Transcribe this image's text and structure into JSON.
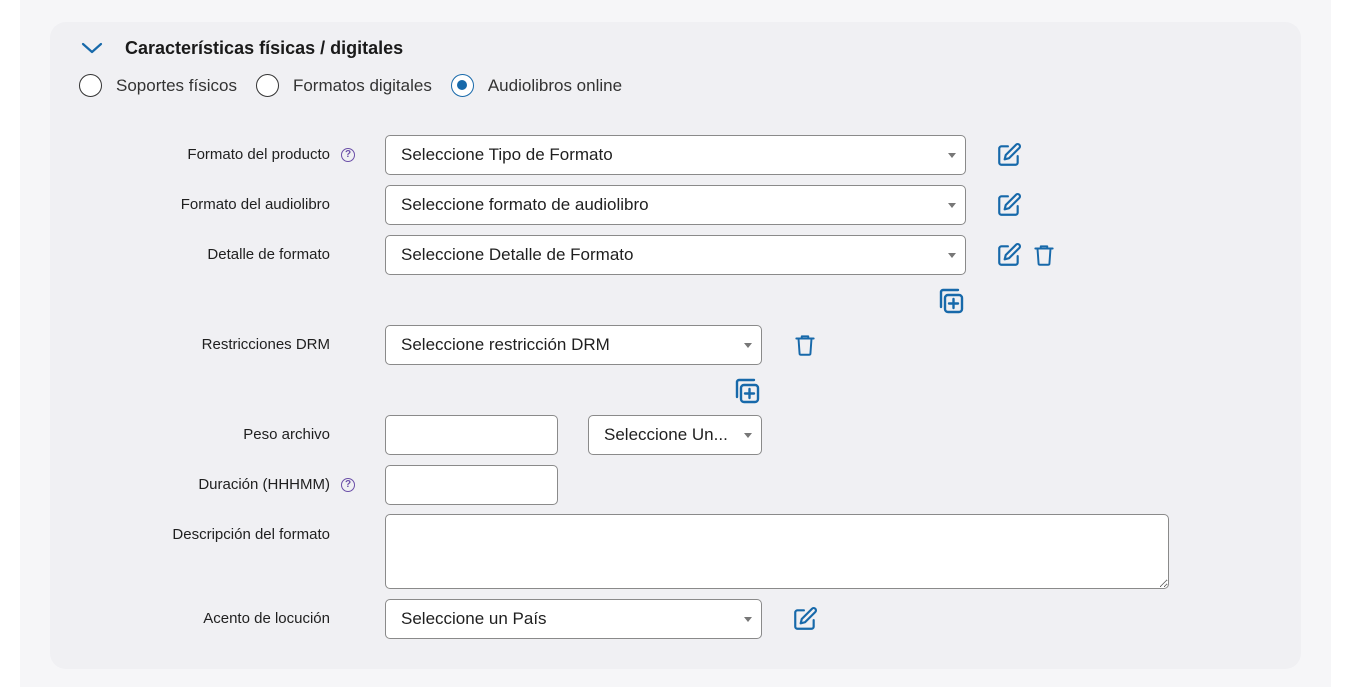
{
  "section": {
    "title": "Características físicas / digitales"
  },
  "radios": [
    {
      "label": "Soportes físicos",
      "selected": false
    },
    {
      "label": "Formatos digitales",
      "selected": false
    },
    {
      "label": "Audiolibros online",
      "selected": true
    }
  ],
  "fields": {
    "formato_producto": {
      "label": "Formato del producto",
      "value": "Seleccione Tipo de Formato"
    },
    "formato_audiolibro": {
      "label": "Formato del audiolibro",
      "value": "Seleccione formato de audiolibro"
    },
    "detalle_formato": {
      "label": "Detalle de formato",
      "value": "Seleccione Detalle de Formato"
    },
    "restricciones_drm": {
      "label": "Restricciones DRM",
      "value": "Seleccione restricción DRM"
    },
    "peso_archivo": {
      "label": "Peso archivo",
      "value": "",
      "unit_value": "Seleccione Un..."
    },
    "duracion": {
      "label": "Duración (HHHMM)",
      "value": ""
    },
    "descripcion_formato": {
      "label": "Descripción del formato",
      "value": ""
    },
    "acento_locucion": {
      "label": "Acento de locución",
      "value": "Seleccione un País"
    }
  },
  "icons": {
    "help": "?",
    "accent_color": "#1769aa",
    "help_color": "#6b4fa8"
  }
}
